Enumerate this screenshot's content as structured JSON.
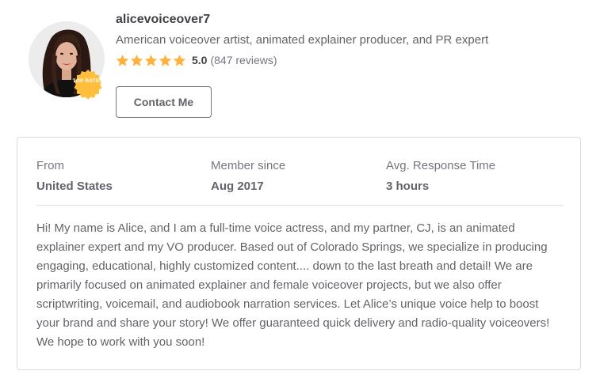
{
  "seller": {
    "username": "alicevoiceover7",
    "tagline": "American voiceover artist, animated explainer producer, and PR expert",
    "badge": "TOP RATED",
    "rating": {
      "stars": 5,
      "score": "5.0",
      "reviews": "(847 reviews)",
      "star_color": "#ffb33e"
    },
    "contact_label": "Contact Me"
  },
  "stats": [
    {
      "label": "From",
      "value": "United States"
    },
    {
      "label": "Member since",
      "value": "Aug 2017"
    },
    {
      "label": "Avg. Response Time",
      "value": "3 hours"
    }
  ],
  "description": "Hi! My name is Alice, and I am a full-time voice actress, and my partner, CJ, is an animated explainer expert and my VO producer. Based out of Colorado Springs, we specialize in producing engaging, educational, highly customized content.... down to the last breath and detail! We are primarily focused on animated explainer and female voiceover projects, but we also offer scriptwriting, voicemail, and audiobook narration services. Let Alice’s unique voice help to boost your brand and share your story! We offer guaranteed quick delivery and radio-quality voiceovers! We hope to work with you soon!",
  "colors": {
    "badge": "#ffbe3c",
    "border": "#dadbdd",
    "text_dark": "#404145",
    "text": "#62646a"
  }
}
